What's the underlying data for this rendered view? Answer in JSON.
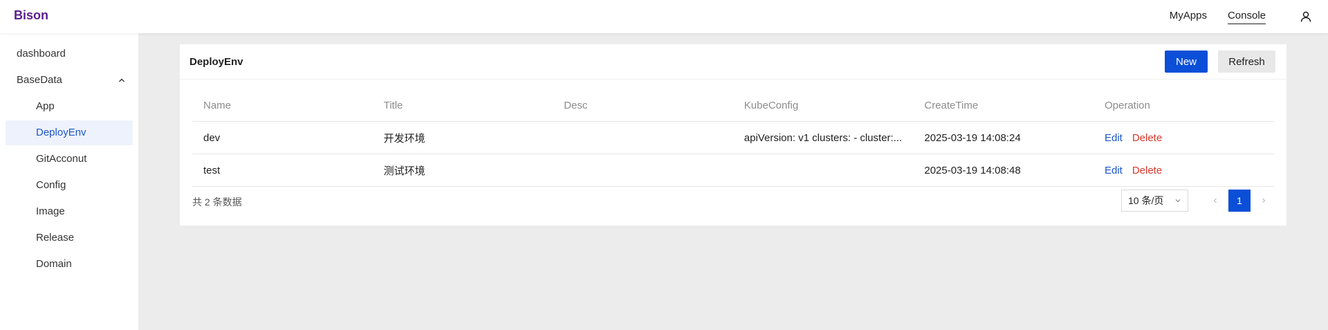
{
  "app": {
    "brand": "Bison"
  },
  "topnav": {
    "myapps": "MyApps",
    "console": "Console"
  },
  "sidebar": {
    "dashboard": "dashboard",
    "basedata": "BaseData",
    "items": [
      "App",
      "DeployEnv",
      "GitAcconut",
      "Config",
      "Image",
      "Release",
      "Domain"
    ]
  },
  "card": {
    "title": "DeployEnv",
    "new_label": "New",
    "refresh_label": "Refresh"
  },
  "table": {
    "columns": [
      "Name",
      "Title",
      "Desc",
      "KubeConfig",
      "CreateTime",
      "Operation"
    ],
    "rows": [
      {
        "name": "dev",
        "title": "开发环境",
        "desc": "",
        "kubeconfig": "apiVersion: v1 clusters: - cluster:...",
        "createtime": "2025-03-19 14:08:24",
        "edit": "Edit",
        "delete": "Delete"
      },
      {
        "name": "test",
        "title": "测试环境",
        "desc": "",
        "kubeconfig": "",
        "createtime": "2025-03-19 14:08:48",
        "edit": "Edit",
        "delete": "Delete"
      }
    ]
  },
  "pagination": {
    "total_text": "共 2 条数据",
    "page_size": "10 条/页",
    "current_page": "1"
  },
  "colors": {
    "brand": "#5b1e8c",
    "primary": "#0b4fd8",
    "link": "#1c56c6",
    "danger": "#d9362b"
  }
}
